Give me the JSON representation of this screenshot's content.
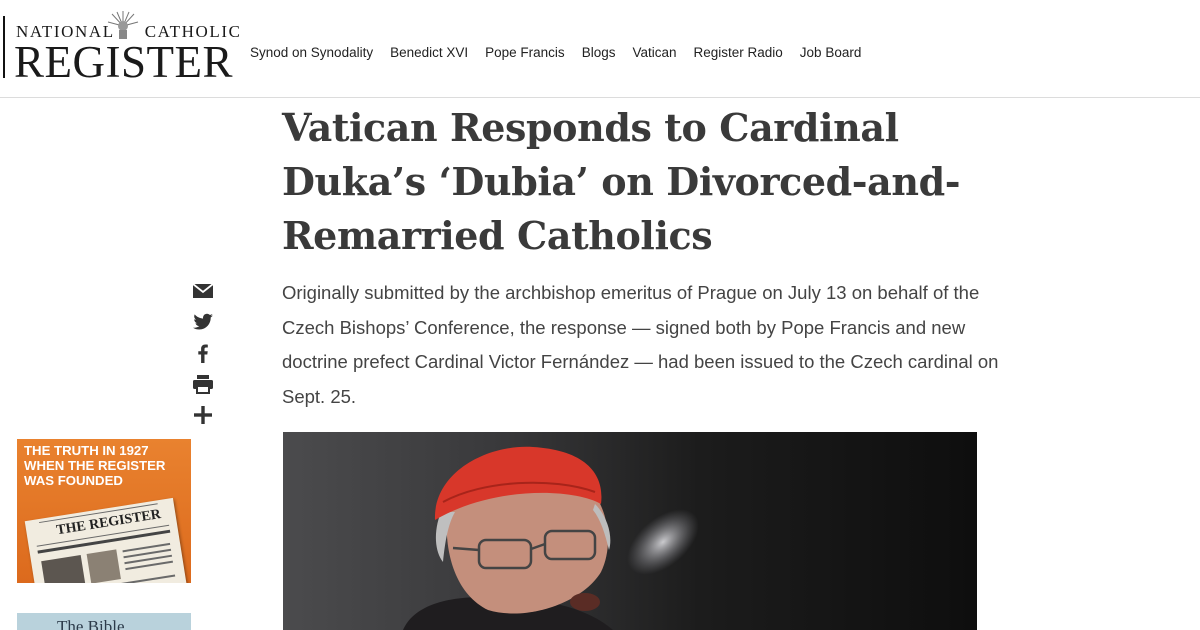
{
  "site": {
    "logo_small_left": "NATIONAL",
    "logo_small_right": "CATHOLIC",
    "logo_big": "REGISTER"
  },
  "nav": {
    "items": [
      {
        "label": "Synod on Synodality"
      },
      {
        "label": "Benedict XVI"
      },
      {
        "label": "Pope Francis"
      },
      {
        "label": "Blogs"
      },
      {
        "label": "Vatican"
      },
      {
        "label": "Register Radio"
      },
      {
        "label": "Job Board"
      }
    ]
  },
  "article": {
    "headline": "Vatican Responds to Cardinal Duka’s ‘Dubia’ on Divorced-and-Remarried Catholics",
    "dek": "Originally submitted by the archbishop emeritus of Prague on July 13 on behalf of the Czech Bishops’ Conference, the response — signed both by Pope Francis and new doctrine prefect Cardinal Victor Fernández — had been issued to the Czech cardinal on Sept. 25."
  },
  "share": {
    "icons": [
      "email-icon",
      "twitter-icon",
      "facebook-icon",
      "print-icon",
      "plus-icon"
    ]
  },
  "promo1": {
    "text": "THE TRUTH IN 1927 WHEN THE REGISTER WAS FOUNDED",
    "paper_title": "THE REGISTER"
  },
  "promo2": {
    "text": "The Bible"
  },
  "colors": {
    "promo_orange": "#e07426",
    "cardinal_red": "#d8372a",
    "headline": "#3a3a3a"
  }
}
